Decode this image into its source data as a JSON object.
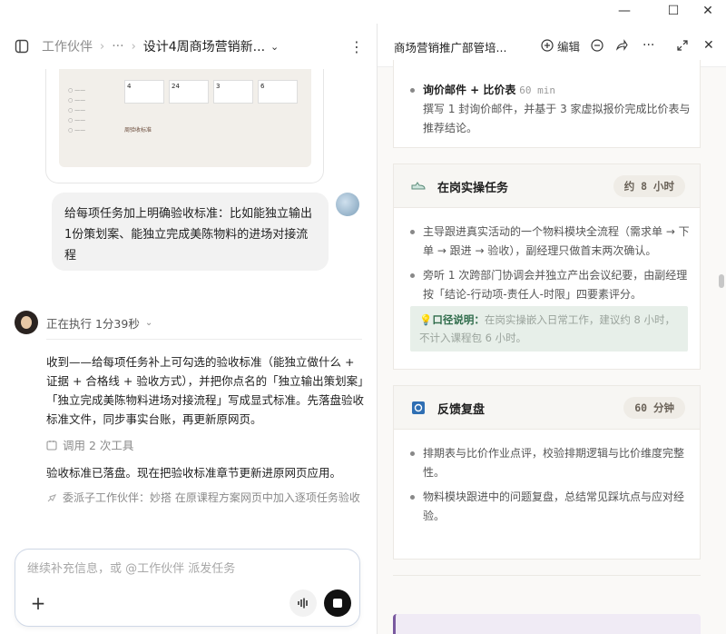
{
  "window": {
    "minimize": "—",
    "maximize": "☐",
    "close": "✕"
  },
  "left": {
    "breadcrumb": {
      "root": "工作伙伴",
      "ellipsis": "···",
      "current": "设计4周商场营销新..."
    },
    "thumbnail": {
      "stats": [
        "4",
        "24",
        "3",
        "6"
      ],
      "caption": "周验收标准"
    },
    "user_message": "给每项任务加上明确验收标准：比如能独立输出1份策划案、能独立完成美陈物料的进场对接流程",
    "status": "正在执行 1分39秒",
    "agent_message": "收到——给每项任务补上可勾选的验收标准（能独立做什么 + 证据 + 合格线 + 验收方式），并把你点名的「独立输出策划案」「独立完成美陈物料进场对接流程」写成显式标准。先落盘验收标准文件，同步事实台账，再更新原网页。",
    "tool_calls": "调用 2 次工具",
    "done_message": "验收标准已落盘。现在把验收标准章节更新进原网页应用。",
    "dispatch": "委派子工作伙伴：妙搭 在原课程方案网页中加入逐项任务验收",
    "composer_placeholder": "继续补充信息，或 @工作伙伴 派发任务"
  },
  "right": {
    "doc_title": "商场营销推广部管培...",
    "edit_label": "编辑",
    "top_item": {
      "title": "询价邮件 + 比价表",
      "duration": "60 min",
      "desc": "撰写 1 封询价邮件，并基于 3 家虚拟报价完成比价表与推荐结论。"
    },
    "cards": [
      {
        "title": "在岗实操任务",
        "badge": "约 8 小时",
        "bullets": [
          "主导跟进真实活动的一个物料模块全流程（需求单 → 下单 → 跟进 → 验收），副经理只做首末两次确认。",
          "旁听 1 次跨部门协调会并独立产出会议纪要，由副经理按「结论-行动项-责任人-时限」四要素评分。"
        ],
        "note_label": "口径说明：",
        "note_text": "在岗实操嵌入日常工作，建议约 8 小时，不计入课程包 6 小时。"
      },
      {
        "title": "反馈复盘",
        "badge": "60 分钟",
        "bullets": [
          "排期表与比价作业点评，校验排期逻辑与比价维度完整性。",
          "物料模块跟进中的问题复盘，总结常见踩坑点与应对经验。"
        ]
      }
    ]
  }
}
